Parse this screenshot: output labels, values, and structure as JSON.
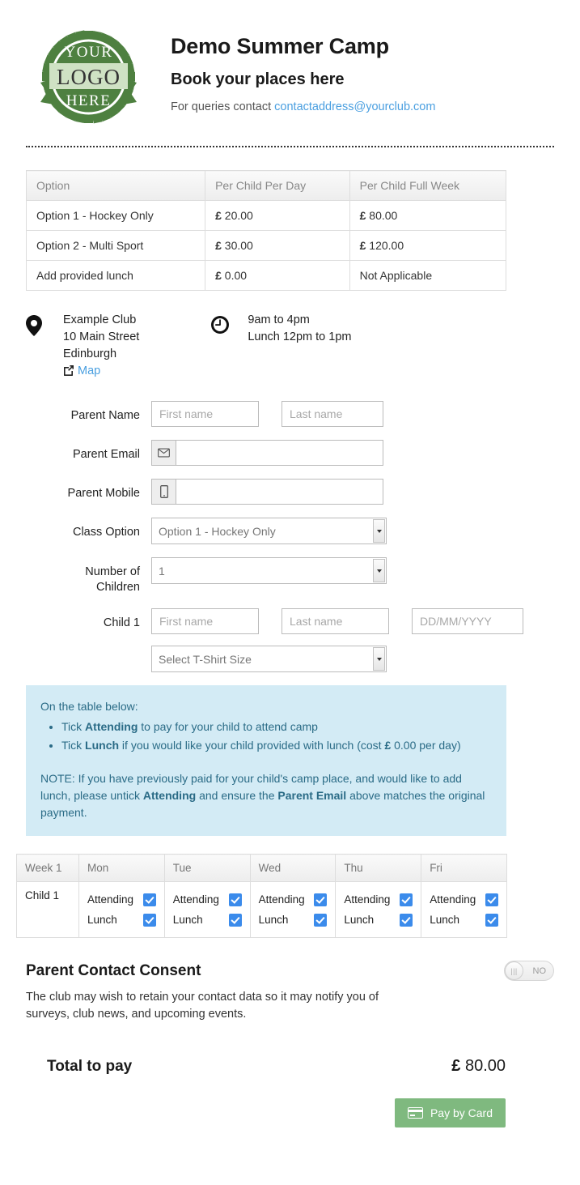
{
  "header": {
    "logo_lines": [
      "YOUR",
      "LOGO",
      "HERE"
    ],
    "title": "Demo Summer Camp",
    "subtitle": "Book your places here",
    "contact_prefix": "For queries contact ",
    "contact_email": "contactaddress@yourclub.com"
  },
  "price_table": {
    "columns": [
      "Option",
      "Per Child Per Day",
      "Per Child Full Week"
    ],
    "rows": [
      {
        "option": "Option 1 - Hockey Only",
        "per_day_sym": "£",
        "per_day": " 20.00",
        "full_week_sym": "£",
        "full_week": " 80.00"
      },
      {
        "option": "Option 2 - Multi Sport",
        "per_day_sym": "£",
        "per_day": " 30.00",
        "full_week_sym": "£",
        "full_week": " 120.00"
      },
      {
        "option": "Add provided lunch",
        "per_day_sym": "£",
        "per_day": " 0.00",
        "full_week_sym": "",
        "full_week": "Not Applicable"
      }
    ]
  },
  "venue": {
    "icon": "map-pin-icon",
    "name": "Example Club",
    "street": "10 Main Street",
    "city": "Edinburgh",
    "map_link": "Map"
  },
  "times": {
    "icon": "clock-icon",
    "hours": "9am to 4pm",
    "lunch": "Lunch 12pm to 1pm"
  },
  "form": {
    "parent_name_label": "Parent Name",
    "parent_first_placeholder": "First name",
    "parent_first_value": "",
    "parent_last_placeholder": "Last name",
    "parent_last_value": "",
    "parent_email_label": "Parent Email",
    "parent_email_value": "",
    "parent_mobile_label": "Parent Mobile",
    "parent_mobile_value": "",
    "class_option_label": "Class Option",
    "class_option_value": "Option 1 - Hockey Only",
    "number_children_label_1": "Number of",
    "number_children_label_2": "Children",
    "number_children_value": "1",
    "child_label": "Child 1",
    "child_first_placeholder": "First name",
    "child_first_value": "",
    "child_last_placeholder": "Last name",
    "child_last_value": "",
    "child_dob_placeholder": "DD/MM/YYYY",
    "child_dob_value": "",
    "tshirt_value": "Select T-Shirt Size"
  },
  "notice": {
    "intro": "On the table below:",
    "bullet1_pre": "Tick ",
    "bullet1_bold": "Attending",
    "bullet1_post": " to pay for your child to attend camp",
    "bullet2_pre": "Tick ",
    "bullet2_bold": "Lunch",
    "bullet2_mid": " if you would like your child provided with lunch (cost ",
    "bullet2_sym": "£",
    "bullet2_post": " 0.00 per day)",
    "note_pre": "NOTE: If you have previously paid for your child's camp place, and would like to add lunch, please untick ",
    "note_bold1": "Attending",
    "note_mid": " and ensure the ",
    "note_bold2": "Parent Email",
    "note_post": " above matches the original payment."
  },
  "week_table": {
    "columns": [
      "Week 1",
      "Mon",
      "Tue",
      "Wed",
      "Thu",
      "Fri"
    ],
    "row_label": "Child 1",
    "attending_label": "Attending",
    "lunch_label": "Lunch",
    "days": [
      {
        "day": "Mon",
        "attending": true,
        "lunch": true
      },
      {
        "day": "Tue",
        "attending": true,
        "lunch": true
      },
      {
        "day": "Wed",
        "attending": true,
        "lunch": true
      },
      {
        "day": "Thu",
        "attending": true,
        "lunch": true
      },
      {
        "day": "Fri",
        "attending": true,
        "lunch": true
      }
    ]
  },
  "consent": {
    "title": "Parent Contact Consent",
    "toggle_state": "NO",
    "toggle_grip": "|||",
    "body": "The club may wish to retain your contact data so it may notify you of surveys, club news, and upcoming events."
  },
  "total": {
    "label": "Total to pay",
    "sym": "£",
    "amount": " 80.00"
  },
  "pay_button": {
    "label": "Pay by Card",
    "icon": "credit-card-icon"
  },
  "colors": {
    "logo_green": "#4e8040",
    "link_blue": "#4a9fe0",
    "checkbox_blue": "#3b8beb",
    "notice_bg": "#d3ebf5",
    "notice_text": "#2a6b86",
    "pay_button_bg": "#7fb97f"
  }
}
